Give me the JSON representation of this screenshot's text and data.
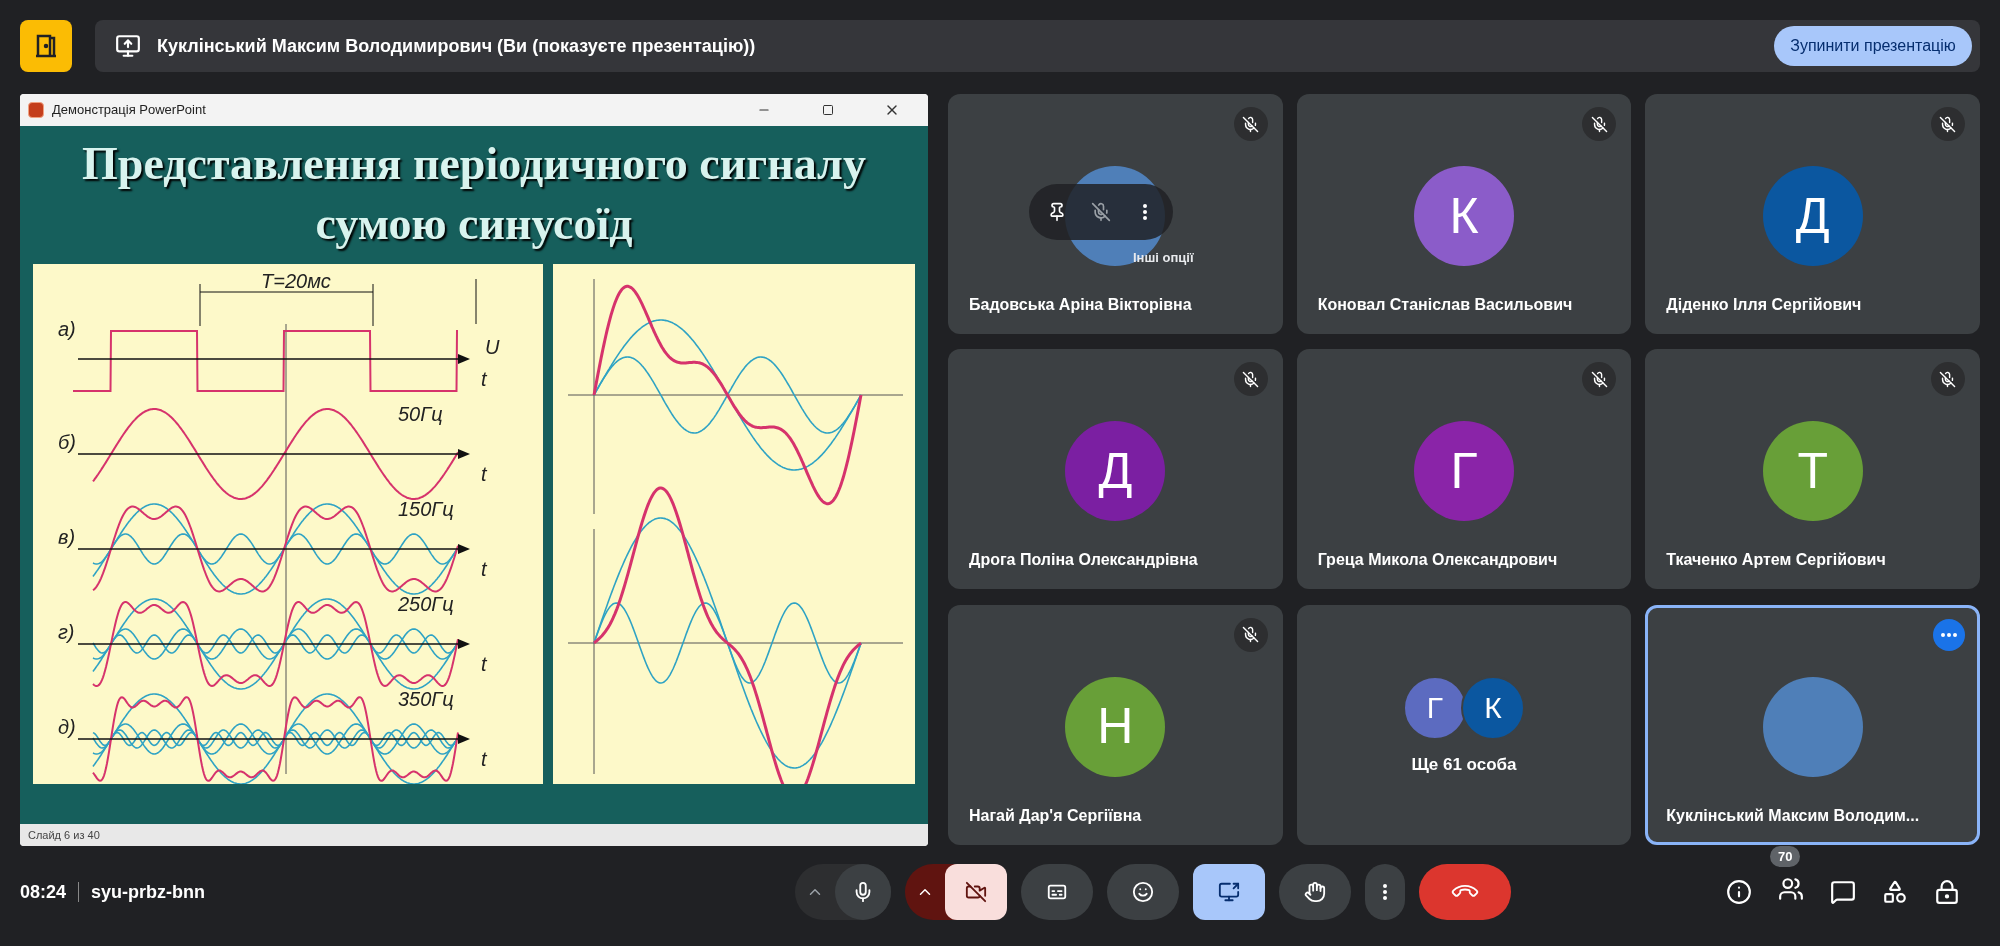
{
  "top_bar": {
    "presenter_label": "Куклінський Максим Володимирович (Ви (показуєте презентацію))",
    "stop_button": "Зупинити презентацію"
  },
  "presentation_window": {
    "title": "Демонстрація PowerPoint",
    "status": "Слайд 6 из 40",
    "slide": {
      "title_line_1": "Представлення періодичного сигналу",
      "title_line_2": "сумою синусоїд",
      "period_label": "T=20мс",
      "amplitude_label": "U",
      "rows": [
        {
          "label": "а)",
          "kind": "square",
          "axis_label": "t"
        },
        {
          "label": "б)",
          "kind": "harmonic",
          "axis_label": "t",
          "frequency": "50Гц"
        },
        {
          "label": "в)",
          "kind": "harmonic",
          "axis_label": "t",
          "frequency": "150Гц"
        },
        {
          "label": "г)",
          "kind": "harmonic",
          "axis_label": "t",
          "frequency": "250Гц"
        },
        {
          "label": "д)",
          "kind": "harmonic",
          "axis_label": "t",
          "frequency": "350Гц"
        }
      ]
    }
  },
  "tiles": [
    {
      "kind": "photo",
      "name": "Бадовська Аріна Вікторівна",
      "muted": true,
      "selected": false,
      "hover_menu": {
        "tooltip": "Інші опції"
      }
    },
    {
      "kind": "initial",
      "name": "Коновал Станіслав Васильович",
      "initial": "К",
      "color": "#8b5cc9",
      "muted": true,
      "selected": false
    },
    {
      "kind": "initial",
      "name": "Діденко Ілля Сергійович",
      "initial": "Д",
      "color": "#0b57a0",
      "muted": true,
      "selected": false
    },
    {
      "kind": "initial",
      "name": "Дрога Поліна Олександрівна",
      "initial": "Д",
      "color": "#7b1fa2",
      "muted": true,
      "selected": false
    },
    {
      "kind": "initial",
      "name": "Греца Микола Олександрович",
      "initial": "Г",
      "color": "#8a24a8",
      "muted": true,
      "selected": false
    },
    {
      "kind": "initial",
      "name": "Ткаченко Артем Сергійович",
      "initial": "Т",
      "color": "#689f38",
      "muted": true,
      "selected": false
    },
    {
      "kind": "initial",
      "name": "Нагай Дар'я Сергіївна",
      "initial": "Н",
      "color": "#689f38",
      "muted": true,
      "selected": false
    },
    {
      "kind": "overflow",
      "name": "Ще 61 особа",
      "avatars": [
        {
          "initial": "Г",
          "color": "#5c6bc0"
        },
        {
          "initial": "К",
          "color": "#0b57a0"
        }
      ],
      "muted": false,
      "selected": false
    },
    {
      "kind": "photo",
      "name": "Куклінський Максим Володим...",
      "muted": false,
      "selected": true
    }
  ],
  "bottom_bar": {
    "time": "08:24",
    "meeting_code": "syu-prbz-bnn",
    "mic_on": true,
    "camera_on": false,
    "presenting": true,
    "people_count": "70"
  }
}
